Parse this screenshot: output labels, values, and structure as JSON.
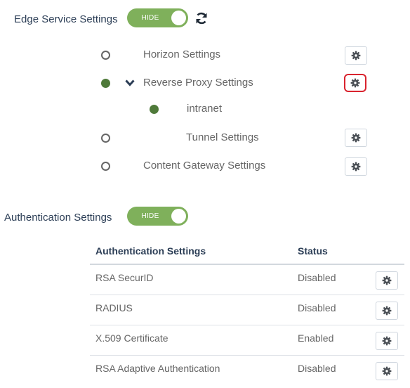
{
  "edge": {
    "title": "Edge Service Settings",
    "toggle_label": "HIDE",
    "items": [
      {
        "label": "Horizon Settings",
        "selected": false
      },
      {
        "label": "Reverse Proxy Settings",
        "selected": true,
        "expanded": true
      },
      {
        "label": "intranet",
        "selected": true
      },
      {
        "label": "Tunnel Settings",
        "selected": false
      },
      {
        "label": "Content Gateway Settings",
        "selected": false
      }
    ]
  },
  "auth": {
    "title": "Authentication Settings",
    "toggle_label": "HIDE",
    "table": {
      "headers": [
        "Authentication Settings",
        "Status"
      ],
      "rows": [
        {
          "name": "RSA SecurID",
          "status": "Disabled"
        },
        {
          "name": "RADIUS",
          "status": "Disabled"
        },
        {
          "name": "X.509 Certificate",
          "status": "Enabled"
        },
        {
          "name": "RSA Adaptive Authentication",
          "status": "Disabled"
        }
      ]
    }
  },
  "colors": {
    "toggle_green": "#7fb05b",
    "selected_radio": "#4f7a3a",
    "highlight_red": "#d9232e",
    "heading_navy": "#2c3e56"
  },
  "icons": [
    "refresh-icon",
    "chevron-down-icon",
    "gear-icon"
  ]
}
